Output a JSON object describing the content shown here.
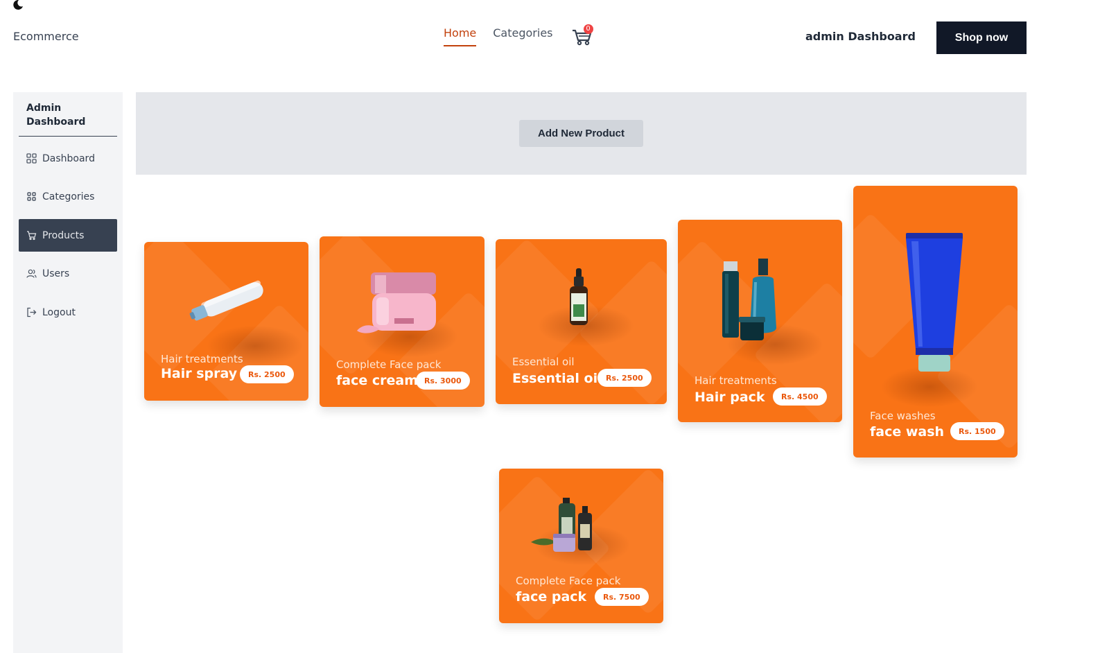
{
  "header": {
    "brand": "Ecommerce",
    "nav": [
      "Home",
      "Categories"
    ],
    "cart_count": "0",
    "admin_link": "admin Dashboard",
    "shop_button": "Shop now"
  },
  "sidebar": {
    "title": "Admin Dashboard",
    "items": [
      {
        "label": "Dashboard",
        "icon": "grid-icon"
      },
      {
        "label": "Categories",
        "icon": "grid-small-icon"
      },
      {
        "label": "Products",
        "icon": "cart-icon",
        "active": true
      },
      {
        "label": "Users",
        "icon": "users-icon"
      },
      {
        "label": "Logout",
        "icon": "logout-icon"
      }
    ]
  },
  "main": {
    "add_button": "Add New Product",
    "products": [
      {
        "category": "Hair treatments",
        "name": "Hair spray",
        "price": "Rs. 2500",
        "image": "spray-bottle"
      },
      {
        "category": "Complete Face pack",
        "name": "face cream",
        "price": "Rs. 3000",
        "image": "cream-jar"
      },
      {
        "category": "Essential oil",
        "name": "Essential oil",
        "price": "Rs. 2500",
        "image": "dropper-bottle"
      },
      {
        "category": "Hair treatments",
        "name": "Hair pack",
        "price": "Rs. 4500",
        "image": "bottle-set"
      },
      {
        "category": "Face washes",
        "name": "face wash",
        "price": "Rs. 1500",
        "image": "tube"
      },
      {
        "category": "Complete Face pack",
        "name": "face pack",
        "price": "Rs. 7500",
        "image": "pump-bottles"
      }
    ]
  },
  "colors": {
    "card": "#f97316",
    "active_nav": "#c2410c",
    "dark": "#111827",
    "sidebar_active": "#374151"
  }
}
